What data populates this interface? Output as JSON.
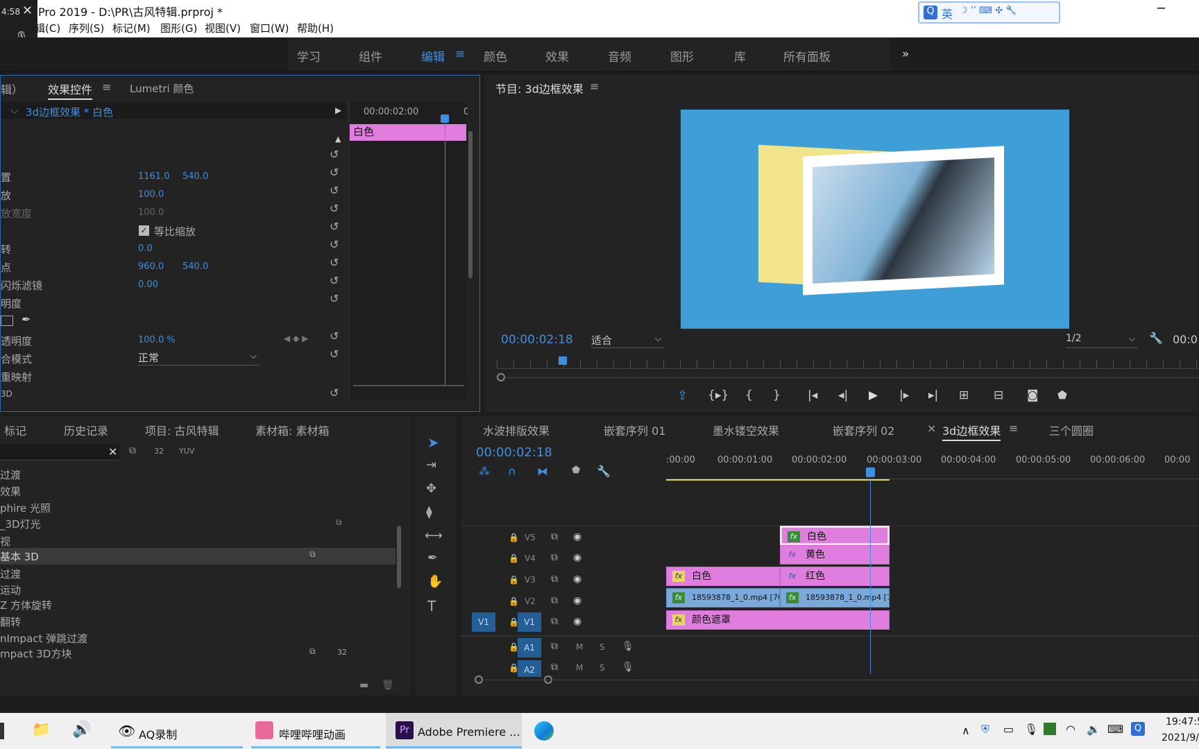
{
  "window": {
    "title": "Pro 2019 - D:\\PR\\古风特辑.prproj *"
  },
  "rec_badge": {
    "time": "4:58"
  },
  "menus": [
    "辑(C)",
    "序列(S)",
    "标记(M)",
    "图形(G)",
    "视图(V)",
    "窗口(W)",
    "帮助(H)"
  ],
  "ime": {
    "mode": "英"
  },
  "workspaces": [
    "学习",
    "组件",
    "编辑",
    "颜色",
    "效果",
    "音频",
    "图形",
    "库",
    "所有面板"
  ],
  "effect_controls": {
    "tab_partial": "辑）",
    "tab": "效果控件",
    "tab2": "Lumetri 颜色",
    "clip_path": "3d边框效果 * 白色",
    "ruler_time1": "00:00:02:00",
    "ruler_time2": "00:00",
    "mini_clip": "白色",
    "props": [
      {
        "label": "置",
        "v1": "1161.0",
        "v2": "540.0"
      },
      {
        "label": "放",
        "v1": "100.0",
        "v2": ""
      },
      {
        "label": "放宽度",
        "v1": "100.0",
        "v2": ""
      },
      {
        "label": "",
        "v1": "",
        "v2": ""
      },
      {
        "label": "转",
        "v1": "0.0",
        "v2": ""
      },
      {
        "label": "点",
        "v1": "960.0",
        "v2": "540.0"
      },
      {
        "label": "闪烁滤镜",
        "v1": "0.00",
        "v2": ""
      },
      {
        "label": "明度",
        "v1": "",
        "v2": ""
      },
      {
        "label": "",
        "v1": "",
        "v2": ""
      },
      {
        "label": "透明度",
        "v1": "100.0 %",
        "v2": ""
      },
      {
        "label": "合模式",
        "v1": "",
        "v2": ""
      },
      {
        "label": "重映射",
        "v1": "",
        "v2": ""
      },
      {
        "label": "3D",
        "v1": "",
        "v2": ""
      }
    ],
    "uniform_scale": "等比缩放",
    "blend_mode": "正常"
  },
  "program": {
    "title": "节目: 3d边框效果",
    "timecode": "00:00:02:18",
    "fit": "适合",
    "resolution": "1/2",
    "right_tc": "00:0"
  },
  "project": {
    "tabs": [
      "标记",
      "历史记录",
      "项目: 古风特辑",
      "素材箱: 素材箱"
    ],
    "items": [
      "过渡",
      "效果",
      "phire 光照",
      "_3D灯光",
      "视",
      "基本 3D",
      "过渡",
      "运动",
      "Z 方体旋转",
      "翻转",
      "nImpact 弹跳过渡",
      "mpact 3D方块"
    ]
  },
  "timeline": {
    "tabs": [
      "水波排版效果",
      "嵌套序列 01",
      "墨水镂空效果",
      "嵌套序列 02",
      "3d边框效果",
      "三个圆圈"
    ],
    "close": "×",
    "timecode": "00:00:02:18",
    "ruler": [
      ":00:00",
      "00:00:01:00",
      "00:00:02:00",
      "00:00:03:00",
      "00:00:04:00",
      "00:00:05:00",
      "00:00:06:00",
      "00:00"
    ],
    "tracks": [
      "V5",
      "V4",
      "V3",
      "V2",
      "V1",
      "A1",
      "A2"
    ],
    "src_v1": "V1",
    "clips": {
      "v5": "白色",
      "v4": "黄色",
      "v3a": "白色",
      "v3b": "红色",
      "v2a": "18593878_1_0.mp4 [70.",
      "v2b": "18593878_1_0.mp4 [70",
      "v1": "颜色遮罩"
    },
    "audio_m": "M",
    "audio_s": "S"
  },
  "taskbar": {
    "apps": [
      "AQ录制",
      "哔哩哔哩动画",
      "Adobe Premiere ..."
    ],
    "time": "19:47:5",
    "date": "2021/9/"
  }
}
